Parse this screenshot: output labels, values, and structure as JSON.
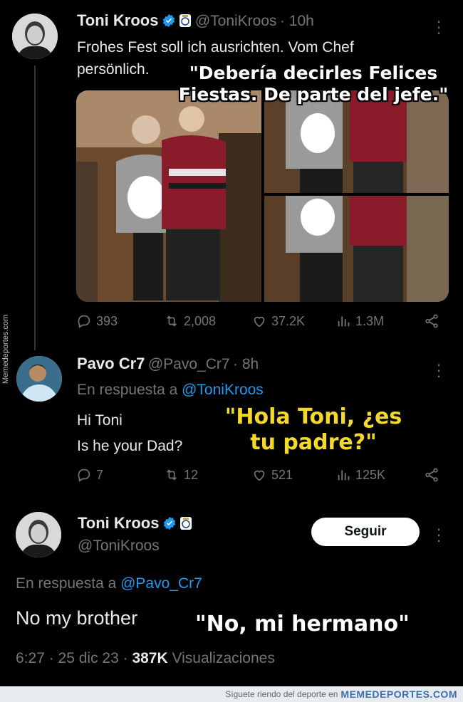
{
  "tweet1": {
    "name": "Toni Kroos",
    "handle": "@ToniKroos",
    "time": "· 10h",
    "text_line1": "Frohes Fest soll ich ausrichten. Vom Chef",
    "text_line2": "persönlich.",
    "caption_line1": "\"Debería decirles Felices",
    "caption_line2": "Fiestas. De parte del jefe.\"",
    "stats": {
      "replies": "393",
      "retweets": "2,008",
      "likes": "37.2K",
      "views": "1.3M"
    }
  },
  "tweet2": {
    "name": "Pavo Cr7",
    "handle": "@Pavo_Cr7",
    "time": "· 8h",
    "reply_prefix": "En respuesta a",
    "reply_to": "@ToniKroos",
    "text_line1": "Hi Toni",
    "text_line2": "Is he your Dad?",
    "caption_line1": "\"Hola Toni, ¿es",
    "caption_line2": "tu padre?\"",
    "stats": {
      "replies": "7",
      "retweets": "12",
      "likes": "521",
      "views": "125K"
    }
  },
  "tweet3": {
    "name": "Toni Kroos",
    "handle": "@ToniKroos",
    "follow_label": "Seguir",
    "reply_prefix": "En respuesta a",
    "reply_to": "@Pavo_Cr7",
    "text": "No my brother",
    "caption": "\"No, mi hermano\"",
    "meta_time": "6:27 · 25 dic 23 ·",
    "meta_views": "387K",
    "meta_views_label": "Visualizaciones"
  },
  "watermark": {
    "side": "Memedeportes.com",
    "footer_text": "Síguete riendo del deporte en",
    "footer_brand": "MEMEDEPORTES.COM"
  },
  "colors": {
    "background": "#000000",
    "link": "#1d9bf0",
    "muted": "#71767b",
    "caption_yellow": "#f4d92a"
  }
}
